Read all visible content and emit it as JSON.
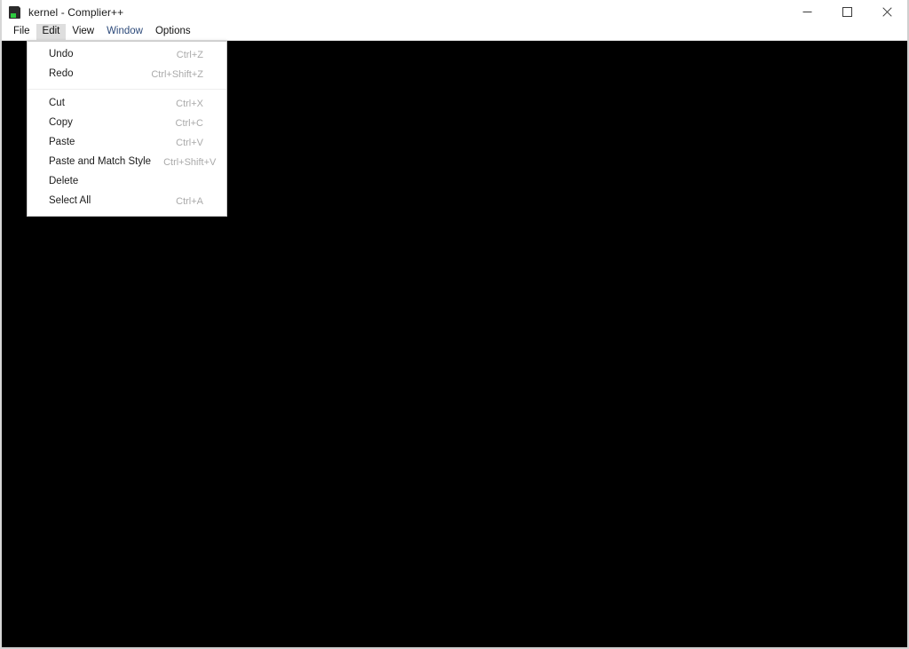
{
  "window": {
    "title": "kernel - Complier++",
    "icon": "document-app-icon",
    "controls": [
      {
        "name": "minimize",
        "glyph": "minimize-icon"
      },
      {
        "name": "maximize",
        "glyph": "maximize-icon"
      },
      {
        "name": "close",
        "glyph": "close-icon"
      }
    ]
  },
  "menubar": {
    "items": [
      {
        "label": "File",
        "state": "normal"
      },
      {
        "label": "Edit",
        "state": "active"
      },
      {
        "label": "View",
        "state": "normal"
      },
      {
        "label": "Window",
        "state": "accent"
      },
      {
        "label": "Options",
        "state": "normal"
      }
    ]
  },
  "edit_menu": {
    "groups": [
      {
        "items": [
          {
            "label": "Undo",
            "shortcut": "Ctrl+Z"
          },
          {
            "label": "Redo",
            "shortcut": "Ctrl+Shift+Z"
          }
        ]
      },
      {
        "items": [
          {
            "label": "Cut",
            "shortcut": "Ctrl+X"
          },
          {
            "label": "Copy",
            "shortcut": "Ctrl+C"
          },
          {
            "label": "Paste",
            "shortcut": "Ctrl+V"
          },
          {
            "label": "Paste and Match Style",
            "shortcut": "Ctrl+Shift+V"
          },
          {
            "label": "Delete",
            "shortcut": ""
          },
          {
            "label": "Select All",
            "shortcut": "Ctrl+A"
          }
        ]
      }
    ]
  },
  "content": {
    "background_color": "#000000",
    "text": ""
  },
  "colors": {
    "titlebar_bg": "#ffffff",
    "menubar_bg": "#ffffff",
    "menu_active_bg": "#dedede",
    "menu_accent_text": "#2d4a7a",
    "shortcut_text": "#aaaaaa",
    "content_bg": "#000000",
    "window_border": "#cfcfcf"
  }
}
